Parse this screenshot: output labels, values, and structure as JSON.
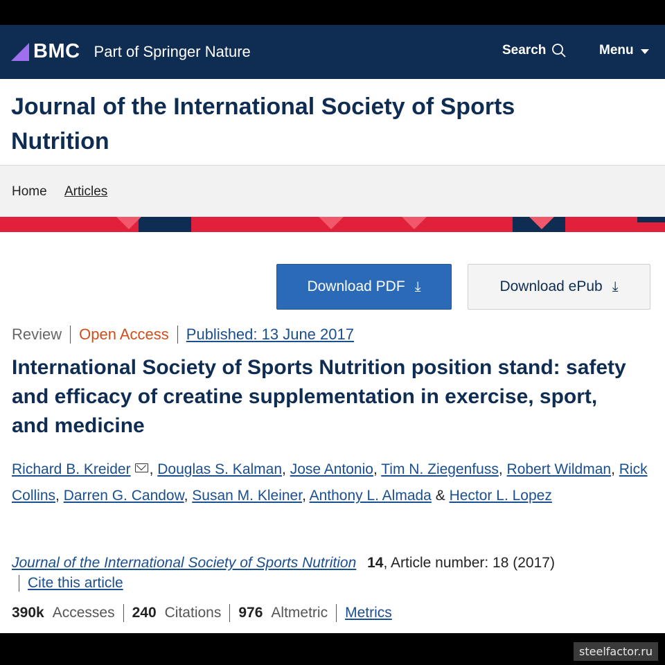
{
  "header": {
    "logo": "BMC",
    "tagline": "Part of Springer Nature",
    "search_label": "Search",
    "menu_label": "Menu"
  },
  "journal": {
    "title": "Journal of the International Society of Sports Nutrition"
  },
  "breadcrumb": {
    "home": "Home",
    "articles": "Articles"
  },
  "downloads": {
    "pdf": "Download PDF",
    "epub": "Download ePub"
  },
  "article": {
    "type": "Review",
    "access": "Open Access",
    "published": "Published: 13 June 2017",
    "title": "International Society of Sports Nutrition position stand: safety and efficacy of creatine supplementation in exercise, sport, and medicine",
    "authors": [
      "Richard B. Kreider",
      "Douglas S. Kalman",
      "Jose Antonio",
      "Tim N. Ziegenfuss",
      "Robert Wildman",
      "Rick Collins",
      "Darren G. Candow",
      "Susan M. Kleiner",
      "Anthony L. Almada",
      "Hector L. Lopez"
    ],
    "amp": "&",
    "journal_name": "Journal of the International Society of Sports Nutrition",
    "volume": "14",
    "article_number": ", Article number: 18 (2017)",
    "cite_label": "Cite this article"
  },
  "metrics": {
    "accesses_value": "390k",
    "accesses_label": "Accesses",
    "citations_value": "240",
    "citations_label": "Citations",
    "altmetric_value": "976",
    "altmetric_label": "Altmetric",
    "metrics_link": "Metrics"
  },
  "watermark": "steelfactor.ru",
  "colors": {
    "navy": "#0f2c52",
    "accent_red": "#e1213b",
    "link_blue": "#1a4f8f",
    "open_access": "#d04e1b",
    "pdf_button": "#2a6ab6"
  }
}
